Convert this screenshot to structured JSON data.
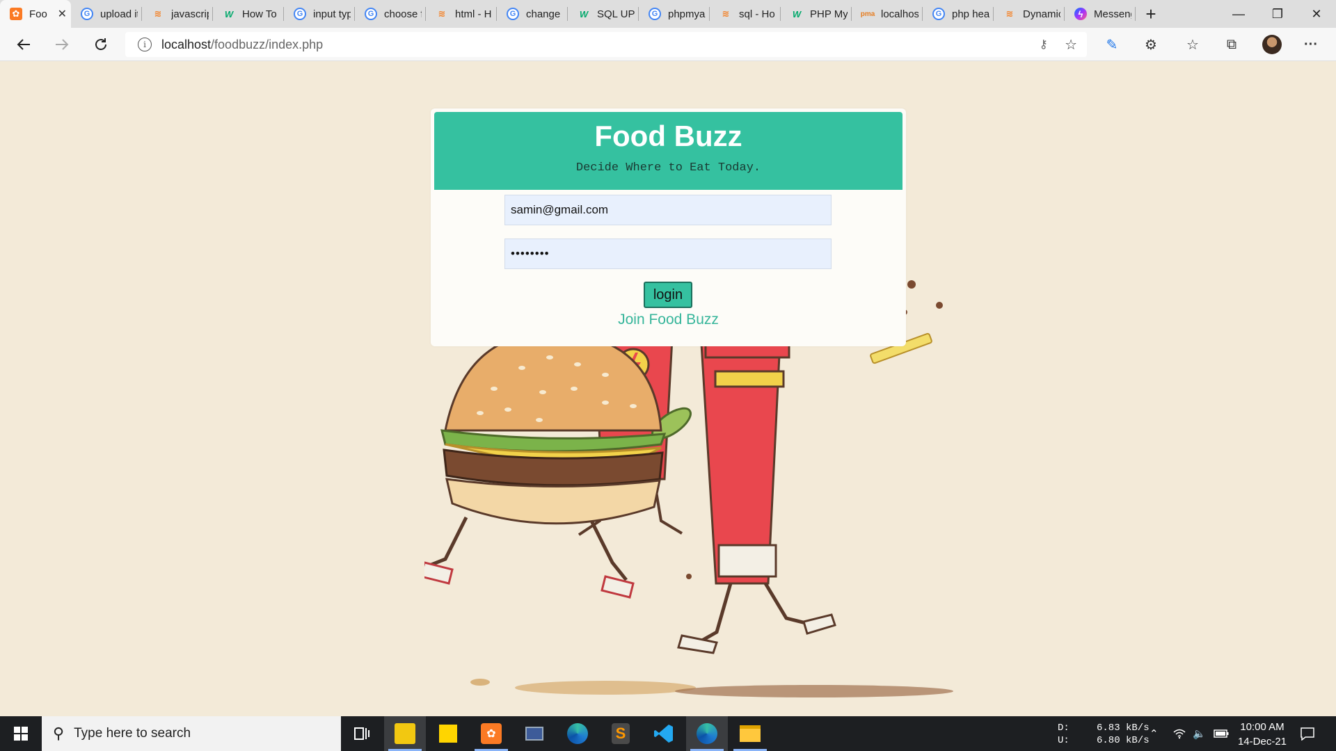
{
  "browser": {
    "tabs": [
      {
        "label": "Foo",
        "favicon": "xampp-icon",
        "active": true
      },
      {
        "label": "upload it",
        "favicon": "google-icon"
      },
      {
        "label": "javascrip",
        "favicon": "stackoverflow-icon"
      },
      {
        "label": "How To",
        "favicon": "w3schools-icon"
      },
      {
        "label": "input typ",
        "favicon": "google-icon"
      },
      {
        "label": "choose f",
        "favicon": "google-icon"
      },
      {
        "label": "html - H",
        "favicon": "stackoverflow-icon"
      },
      {
        "label": "change",
        "favicon": "google-icon"
      },
      {
        "label": "SQL UPD",
        "favicon": "w3schools-icon"
      },
      {
        "label": "phpmya",
        "favicon": "google-icon"
      },
      {
        "label": "sql - Ho",
        "favicon": "stackoverflow-icon"
      },
      {
        "label": "PHP My",
        "favicon": "w3schools-icon"
      },
      {
        "label": "localhos",
        "favicon": "phpmyadmin-icon"
      },
      {
        "label": "php hea",
        "favicon": "google-icon"
      },
      {
        "label": "Dynamic",
        "favicon": "stackoverflow-icon"
      },
      {
        "label": "Messeng",
        "favicon": "messenger-icon"
      }
    ],
    "url_host": "localhost",
    "url_path": "/foodbuzz/index.php"
  },
  "login": {
    "title": "Food Buzz",
    "subtitle": "Decide Where to Eat Today.",
    "email_value": "samin@gmail.com",
    "password_value": "••••••••",
    "login_label": "login",
    "join_label": "Join Food Buzz"
  },
  "taskbar": {
    "search_placeholder": "Type here to search",
    "net_down_label": "D:",
    "net_up_label": "U:",
    "net_down": "6.83 kB/s",
    "net_up": "6.80 kB/s",
    "time": "10:00 AM",
    "date": "14-Dec-21"
  },
  "colors": {
    "accent": "#35c1a0",
    "page_bg": "#f3ead8",
    "taskbar_bg": "#1d1f22"
  }
}
